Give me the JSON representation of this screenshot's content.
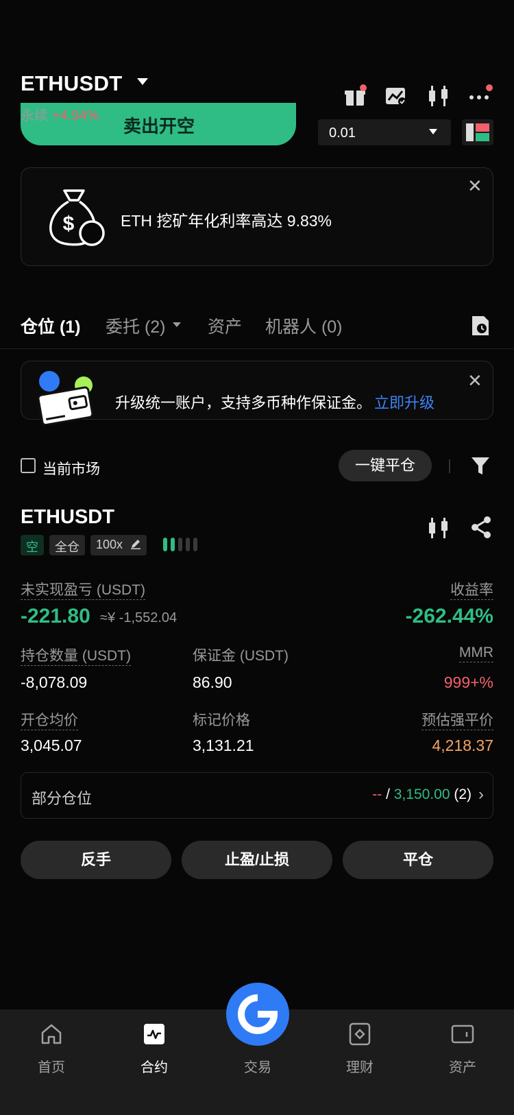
{
  "header": {
    "symbol": "ETHUSDT",
    "contract_type": "永续",
    "change_pct": "+4.94%",
    "icons": [
      "gift-icon",
      "chart-check-icon",
      "candlestick-icon",
      "more-icon"
    ]
  },
  "order": {
    "sell_label": "卖出开空",
    "quantity": "0.01"
  },
  "promo_banner": {
    "text": "ETH 挖矿年化利率高达 9.83%",
    "close": "✕"
  },
  "tabs": [
    {
      "label": "仓位 (1)"
    },
    {
      "label": "委托 (2)"
    },
    {
      "label": "资产"
    },
    {
      "label": "机器人 (0)"
    }
  ],
  "upgrade_banner": {
    "text": "升级统一账户，支持多币种作保证金。",
    "link": "立即升级",
    "close": "✕"
  },
  "filter": {
    "current_market": "当前市场",
    "close_all": "一键平仓"
  },
  "position": {
    "symbol": "ETHUSDT",
    "side_tag": "空",
    "margin_tag": "全仓",
    "leverage_tag": "100x",
    "adl_level": 2,
    "unrealized_pnl_label": "未实现盈亏 (USDT)",
    "unrealized_pnl": "-221.80",
    "unrealized_pnl_cny": "≈¥ -1,552.04",
    "roe_label": "收益率",
    "roe": "-262.44%",
    "size_label": "持仓数量 (USDT)",
    "size": "-8,078.09",
    "margin_label": "保证金 (USDT)",
    "margin": "86.90",
    "mmr_label": "MMR",
    "mmr": "999+%",
    "entry_label": "开仓均价",
    "entry": "3,045.07",
    "mark_label": "标记价格",
    "mark": "3,131.21",
    "liq_label": "预估强平价",
    "liq": "4,218.37",
    "partial_label": "部分仓位",
    "partial_dash": "--",
    "partial_sep": " / ",
    "partial_price": "3,150.00",
    "partial_count": " (2)",
    "actions": [
      "反手",
      "止盈/止损",
      "平仓"
    ]
  },
  "bottom_nav": [
    {
      "label": "首页",
      "icon": "home-icon"
    },
    {
      "label": "合约",
      "icon": "futures-icon"
    },
    {
      "label": "交易",
      "icon": "trade-icon"
    },
    {
      "label": "理财",
      "icon": "earn-icon"
    },
    {
      "label": "资产",
      "icon": "wallet-icon"
    }
  ],
  "colors": {
    "green": "#2fbd85",
    "red": "#f0616d",
    "orange": "#f5a462",
    "blue": "#2f7bf5"
  }
}
